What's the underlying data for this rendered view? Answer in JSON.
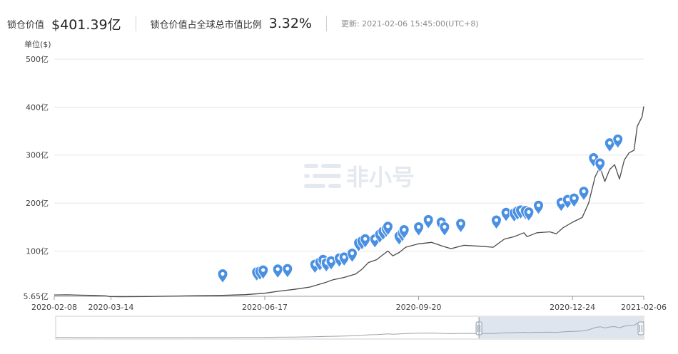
{
  "header": {
    "locked_value_label": "锁仓价值",
    "locked_value": "$401.39亿",
    "ratio_label": "锁仓价值占全球总市值比例",
    "ratio_value": "3.32%",
    "update_label": "更新: 2021-02-06 15:45:00(UTC+8)"
  },
  "watermark": "非小号",
  "colors": {
    "line": "#4a4a4a",
    "pin": "#4a90e2",
    "grid": "#e6e6e6",
    "navigator_mask": "#dfe5ef"
  },
  "chart_data": {
    "type": "line",
    "unit_label": "单位($)",
    "y_ticks": [
      {
        "label": "5.65亿",
        "value": 5.65
      },
      {
        "label": "100亿",
        "value": 100
      },
      {
        "label": "200亿",
        "value": 200
      },
      {
        "label": "300亿",
        "value": 300
      },
      {
        "label": "400亿",
        "value": 400
      },
      {
        "label": "500亿",
        "value": 500
      }
    ],
    "ylim": [
      5.65,
      500
    ],
    "xlim": [
      "2020-02-08",
      "2021-02-06"
    ],
    "x_ticks": [
      "2020-02-08",
      "2020-03-14",
      "2020-06-17",
      "2020-09-20",
      "2020-12-24",
      "2021-02-06"
    ],
    "grid": true,
    "series": [
      {
        "points": [
          [
            "2020-02-08",
            8.5
          ],
          [
            "2020-02-16",
            8.8
          ],
          [
            "2020-02-24",
            8.0
          ],
          [
            "2020-03-04",
            7.5
          ],
          [
            "2020-03-11",
            6.5
          ],
          [
            "2020-03-13",
            5.0
          ],
          [
            "2020-03-20",
            4.8
          ],
          [
            "2020-04-05",
            5.2
          ],
          [
            "2020-04-20",
            6.0
          ],
          [
            "2020-05-05",
            7.0
          ],
          [
            "2020-05-20",
            7.5
          ],
          [
            "2020-06-05",
            9.0
          ],
          [
            "2020-06-17",
            12.0
          ],
          [
            "2020-06-25",
            16.0
          ],
          [
            "2020-07-05",
            20.0
          ],
          [
            "2020-07-15",
            25.0
          ],
          [
            "2020-07-25",
            35.0
          ],
          [
            "2020-07-29",
            40.0
          ],
          [
            "2020-08-05",
            45.0
          ],
          [
            "2020-08-12",
            52.0
          ],
          [
            "2020-08-16",
            62.0
          ],
          [
            "2020-08-20",
            76.0
          ],
          [
            "2020-08-25",
            82.0
          ],
          [
            "2020-09-01",
            100.0
          ],
          [
            "2020-09-04",
            90.0
          ],
          [
            "2020-09-08",
            97.0
          ],
          [
            "2020-09-12",
            108.0
          ],
          [
            "2020-09-20",
            115.0
          ],
          [
            "2020-09-28",
            118.0
          ],
          [
            "2020-10-05",
            110.0
          ],
          [
            "2020-10-10",
            105.0
          ],
          [
            "2020-10-18",
            112.0
          ],
          [
            "2020-10-28",
            110.0
          ],
          [
            "2020-11-05",
            108.0
          ],
          [
            "2020-11-12",
            125.0
          ],
          [
            "2020-11-18",
            130.0
          ],
          [
            "2020-11-24",
            138.0
          ],
          [
            "2020-11-26",
            130.0
          ],
          [
            "2020-12-02",
            138.0
          ],
          [
            "2020-12-10",
            140.0
          ],
          [
            "2020-12-14",
            136.0
          ],
          [
            "2020-12-18",
            148.0
          ],
          [
            "2020-12-24",
            160.0
          ],
          [
            "2020-12-30",
            170.0
          ],
          [
            "2021-01-03",
            200.0
          ],
          [
            "2021-01-07",
            255.0
          ],
          [
            "2021-01-10",
            275.0
          ],
          [
            "2021-01-13",
            245.0
          ],
          [
            "2021-01-16",
            270.0
          ],
          [
            "2021-01-19",
            280.0
          ],
          [
            "2021-01-22",
            250.0
          ],
          [
            "2021-01-25",
            290.0
          ],
          [
            "2021-01-28",
            305.0
          ],
          [
            "2021-01-31",
            310.0
          ],
          [
            "2021-02-02",
            360.0
          ],
          [
            "2021-02-05",
            380.0
          ],
          [
            "2021-02-06",
            401.39
          ]
        ]
      }
    ],
    "event_markers": [
      [
        "2020-05-22",
        45
      ],
      [
        "2020-06-12",
        49
      ],
      [
        "2020-06-14",
        51
      ],
      [
        "2020-06-16",
        53
      ],
      [
        "2020-06-25",
        55
      ],
      [
        "2020-07-01",
        56
      ],
      [
        "2020-07-18",
        65
      ],
      [
        "2020-07-21",
        70
      ],
      [
        "2020-07-23",
        75
      ],
      [
        "2020-07-25",
        68
      ],
      [
        "2020-07-28",
        72
      ],
      [
        "2020-08-02",
        78
      ],
      [
        "2020-08-05",
        80
      ],
      [
        "2020-08-10",
        88
      ],
      [
        "2020-08-14",
        110
      ],
      [
        "2020-08-16",
        114
      ],
      [
        "2020-08-18",
        118
      ],
      [
        "2020-08-24",
        118
      ],
      [
        "2020-08-27",
        128
      ],
      [
        "2020-08-29",
        134
      ],
      [
        "2020-08-31",
        140
      ],
      [
        "2020-09-01",
        144
      ],
      [
        "2020-09-08",
        124
      ],
      [
        "2020-09-10",
        131
      ],
      [
        "2020-09-11",
        137
      ],
      [
        "2020-09-20",
        143
      ],
      [
        "2020-09-26",
        158
      ],
      [
        "2020-10-04",
        153
      ],
      [
        "2020-10-06",
        143
      ],
      [
        "2020-10-16",
        150
      ],
      [
        "2020-11-07",
        157
      ],
      [
        "2020-11-13",
        173
      ],
      [
        "2020-11-18",
        172
      ],
      [
        "2020-11-20",
        176
      ],
      [
        "2020-11-22",
        178
      ],
      [
        "2020-11-25",
        177
      ],
      [
        "2020-11-27",
        174
      ],
      [
        "2020-12-03",
        188
      ],
      [
        "2020-12-17",
        194
      ],
      [
        "2020-12-21",
        200
      ],
      [
        "2020-12-25",
        203
      ],
      [
        "2020-12-31",
        217
      ],
      [
        "2021-01-06",
        287
      ],
      [
        "2021-01-10",
        276
      ],
      [
        "2021-01-16",
        318
      ],
      [
        "2021-01-21",
        326
      ]
    ],
    "navigator": {
      "selected_start": "2020-10-27",
      "selected_end": "2021-02-06"
    }
  }
}
